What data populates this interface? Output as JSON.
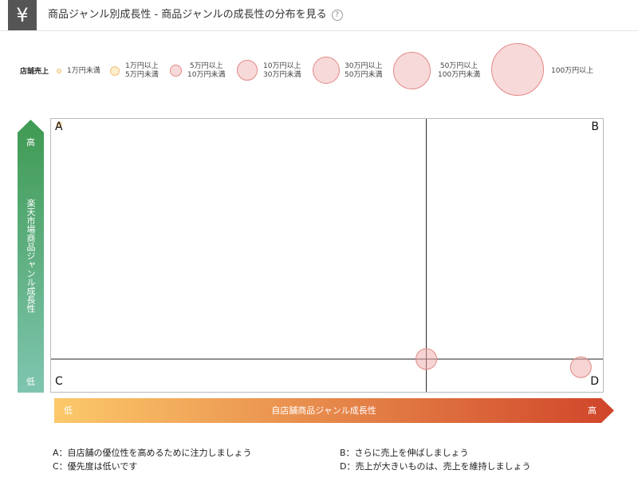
{
  "header": {
    "currency_icon": "yen-icon",
    "currency_glyph": "¥",
    "title": "商品ジャンル別成長性 - 商品ジャンルの成長性の分布を見る",
    "help_glyph": "?"
  },
  "legend": {
    "label": "店舗売上",
    "items": [
      {
        "line1": "1万円未満",
        "line2": ""
      },
      {
        "line1": "1万円以上",
        "line2": "5万円未満"
      },
      {
        "line1": "5万円以上",
        "line2": "10万円未満"
      },
      {
        "line1": "10万円以上",
        "line2": "30万円未満"
      },
      {
        "line1": "30万円以上",
        "line2": "50万円未満"
      },
      {
        "line1": "50万円以上",
        "line2": "100万円未満"
      },
      {
        "line1": "100万円以上",
        "line2": ""
      }
    ]
  },
  "chart_data": {
    "type": "scatter",
    "title": "",
    "xlabel": "自店舗商品ジャンル成長性",
    "ylabel": "楽天市場商品ジャンル成長性",
    "x_low": "低",
    "x_high": "高",
    "y_high": "高",
    "y_low": "低",
    "xlim": [
      0,
      1
    ],
    "ylim": [
      0,
      1
    ],
    "x_divider": 0.68,
    "y_divider": 0.12,
    "quadrants": {
      "top_left": "A",
      "top_right": "B",
      "bottom_left": "C",
      "bottom_right": "D"
    },
    "points": [
      {
        "x": 0.015,
        "y": 0.98,
        "sales_band": 0
      },
      {
        "x": 0.68,
        "y": 0.12,
        "sales_band": 3
      },
      {
        "x": 0.96,
        "y": 0.09,
        "sales_band": 3
      }
    ],
    "colors": {
      "bubble_fill": "#f0aaaa",
      "bubble_stroke": "#e08a86",
      "small_bubble_stroke": "#f0c080",
      "y_gradient_top": "#3f9a52",
      "y_gradient_bottom": "#7fc5b0",
      "x_gradient_left": "#fcc96a",
      "x_gradient_right": "#d0452a"
    }
  },
  "notes": {
    "a": "A：自店舗の優位性を高めるために注力しましょう",
    "b": "B：さらに売上を伸ばしましょう",
    "c": "C：優先度は低いです",
    "d": "D：売上が大きいものは、売上を維持しましょう"
  }
}
